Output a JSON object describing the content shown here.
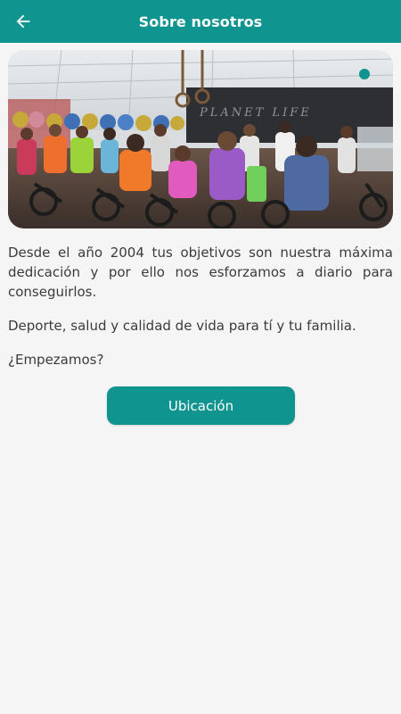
{
  "header": {
    "title": "Sobre nosotros",
    "back_icon": "arrow-left-icon"
  },
  "hero": {
    "wall_sign": "PLANET LIFE"
  },
  "paragraphs": [
    "Desde el año 2004 tus objetivos son nuestra máxima dedicación y por ello nos esforzamos a diario para conseguirlos.",
    "Deporte, salud y calidad de vida para tí y tu familia.",
    "¿Empezamos?"
  ],
  "cta": {
    "label": "Ubicación"
  },
  "colors": {
    "primary": "#0f9490",
    "background": "#f5f5f5",
    "text": "#3b3b3b"
  }
}
